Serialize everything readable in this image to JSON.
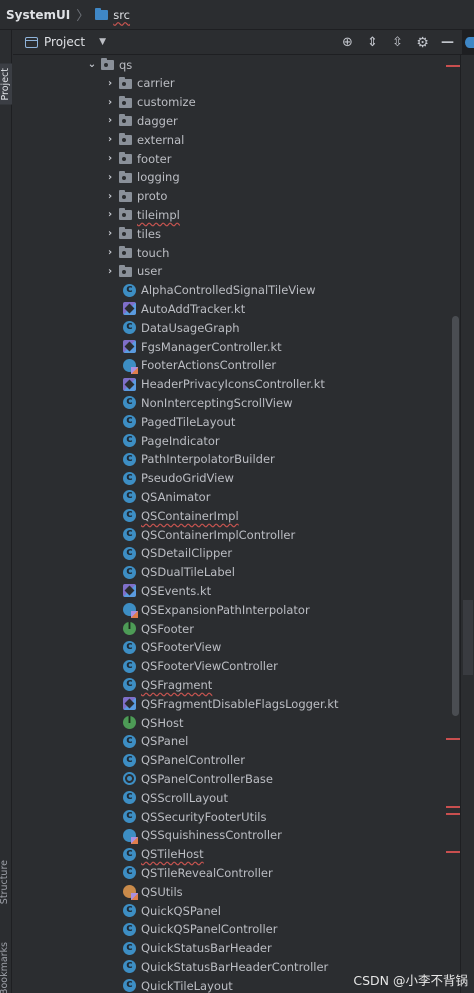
{
  "breadcrumb": {
    "project": "SystemUI",
    "folder": "src"
  },
  "sidebar": {
    "project_tab": "Project",
    "structure_tab": "Structure",
    "bookmarks_tab": "Bookmarks"
  },
  "toolwindow": {
    "title": "Project",
    "caret": "▼"
  },
  "icons": [
    "crosshair-icon",
    "expand-all-icon",
    "collapse-all-icon",
    "gear-icon",
    "minimize-icon"
  ],
  "tree": {
    "root": {
      "chevron": "⌄",
      "label": "qs"
    },
    "folders": [
      {
        "label": "carrier"
      },
      {
        "label": "customize"
      },
      {
        "label": "dagger"
      },
      {
        "label": "external"
      },
      {
        "label": "footer"
      },
      {
        "label": "logging"
      },
      {
        "label": "proto"
      },
      {
        "label": "tileimpl",
        "error": true
      },
      {
        "label": "tiles"
      },
      {
        "label": "touch"
      },
      {
        "label": "user"
      }
    ],
    "files": [
      {
        "label": "AlphaControlledSignalTileView",
        "kind": "class"
      },
      {
        "label": "AutoAddTracker.kt",
        "kind": "kotlin"
      },
      {
        "label": "DataUsageGraph",
        "kind": "class"
      },
      {
        "label": "FgsManagerController.kt",
        "kind": "kotlin"
      },
      {
        "label": "FooterActionsController",
        "kind": "kclass"
      },
      {
        "label": "HeaderPrivacyIconsController.kt",
        "kind": "kotlin"
      },
      {
        "label": "NonInterceptingScrollView",
        "kind": "class"
      },
      {
        "label": "PagedTileLayout",
        "kind": "class"
      },
      {
        "label": "PageIndicator",
        "kind": "class"
      },
      {
        "label": "PathInterpolatorBuilder",
        "kind": "class"
      },
      {
        "label": "PseudoGridView",
        "kind": "class"
      },
      {
        "label": "QSAnimator",
        "kind": "class"
      },
      {
        "label": "QSContainerImpl",
        "kind": "class",
        "error": true
      },
      {
        "label": "QSContainerImplController",
        "kind": "class"
      },
      {
        "label": "QSDetailClipper",
        "kind": "class"
      },
      {
        "label": "QSDualTileLabel",
        "kind": "class"
      },
      {
        "label": "QSEvents.kt",
        "kind": "kotlin"
      },
      {
        "label": "QSExpansionPathInterpolator",
        "kind": "kclass"
      },
      {
        "label": "QSFooter",
        "kind": "iface"
      },
      {
        "label": "QSFooterView",
        "kind": "class"
      },
      {
        "label": "QSFooterViewController",
        "kind": "class"
      },
      {
        "label": "QSFragment",
        "kind": "class",
        "error": true
      },
      {
        "label": "QSFragmentDisableFlagsLogger.kt",
        "kind": "kotlin"
      },
      {
        "label": "QSHost",
        "kind": "iface"
      },
      {
        "label": "QSPanel",
        "kind": "class"
      },
      {
        "label": "QSPanelController",
        "kind": "class"
      },
      {
        "label": "QSPanelControllerBase",
        "kind": "abstract"
      },
      {
        "label": "QSScrollLayout",
        "kind": "class"
      },
      {
        "label": "QSSecurityFooterUtils",
        "kind": "class"
      },
      {
        "label": "QSSquishinessController",
        "kind": "kclass"
      },
      {
        "label": "QSTileHost",
        "kind": "class",
        "error": true
      },
      {
        "label": "QSTileRevealController",
        "kind": "class"
      },
      {
        "label": "QSUtils",
        "kind": "object"
      },
      {
        "label": "QuickQSPanel",
        "kind": "class"
      },
      {
        "label": "QuickQSPanelController",
        "kind": "class"
      },
      {
        "label": "QuickStatusBarHeader",
        "kind": "class"
      },
      {
        "label": "QuickStatusBarHeaderController",
        "kind": "class"
      },
      {
        "label": "QuickTileLayout",
        "kind": "class"
      }
    ]
  },
  "watermark": "CSDN @小李不背锅",
  "colors": {
    "background": "#2b2d30",
    "text": "#bcbec4",
    "class_icon": "#3d8ec4",
    "interface_icon": "#4d9b56",
    "error": "#c94f4f"
  }
}
